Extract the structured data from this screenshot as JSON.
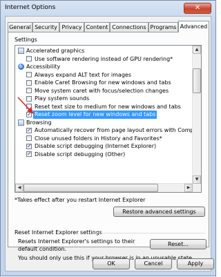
{
  "window": {
    "title": "Internet Options",
    "close_glyph": "✕"
  },
  "tabs": [
    {
      "label": "General",
      "active": false
    },
    {
      "label": "Security",
      "active": false
    },
    {
      "label": "Privacy",
      "active": false
    },
    {
      "label": "Content",
      "active": false
    },
    {
      "label": "Connections",
      "active": false
    },
    {
      "label": "Programs",
      "active": false
    },
    {
      "label": "Advanced",
      "active": true
    }
  ],
  "settings": {
    "label": "Settings",
    "items": [
      {
        "type": "category",
        "icon": "folder-icon",
        "label": "Accelerated graphics"
      },
      {
        "type": "checkbox",
        "checked": false,
        "label": "Use software rendering instead of GPU rendering*"
      },
      {
        "type": "category",
        "icon": "accessibility-icon",
        "label": "Accessibility"
      },
      {
        "type": "checkbox",
        "checked": false,
        "label": "Always expand ALT text for images"
      },
      {
        "type": "checkbox",
        "checked": false,
        "label": "Enable Caret Browsing for new windows and tabs"
      },
      {
        "type": "checkbox",
        "checked": false,
        "label": "Move system caret with focus/selection changes"
      },
      {
        "type": "checkbox",
        "checked": false,
        "label": "Play system sounds"
      },
      {
        "type": "checkbox",
        "checked": false,
        "label": "Reset text size to medium for new windows and tabs"
      },
      {
        "type": "checkbox",
        "checked": true,
        "selected": true,
        "label": "Reset zoom level for new windows and tabs"
      },
      {
        "type": "category",
        "icon": "folder-icon",
        "label": "Browsing"
      },
      {
        "type": "checkbox",
        "checked": true,
        "label": "Automatically recover from page layout errors with Compa"
      },
      {
        "type": "checkbox",
        "checked": false,
        "label": "Close unused folders in History and Favorites*"
      },
      {
        "type": "checkbox",
        "checked": true,
        "label": "Disable script debugging (Internet Explorer)"
      },
      {
        "type": "checkbox",
        "checked": true,
        "label": "Disable script debugging (Other)"
      }
    ],
    "note": "*Takes effect after you restart Internet Explorer",
    "restore_button": "Restore advanced settings"
  },
  "reset_section": {
    "title": "Reset Internet Explorer settings",
    "description": "Resets Internet Explorer's settings to their default condition.",
    "reset_button": "Reset...",
    "warning": "You should only use this if your browser is in an unusable state."
  },
  "footer": {
    "ok": "OK",
    "cancel": "Cancel",
    "apply": "Apply"
  },
  "colors": {
    "selection": "#3399ff",
    "annotation_arrow": "#e3231b"
  }
}
